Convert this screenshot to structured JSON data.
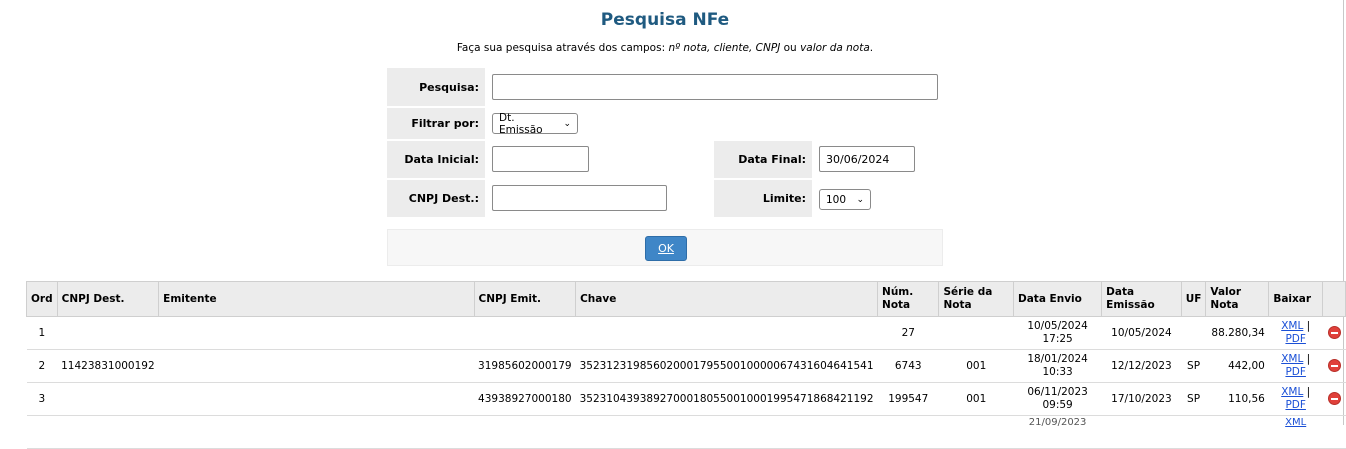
{
  "page": {
    "title": "Pesquisa NFe",
    "subtitle_prefix": "Faça sua pesquisa através dos campos: ",
    "subtitle_fields": "nº nota, cliente, CNPJ",
    "subtitle_or": " ou ",
    "subtitle_last": "valor da nota",
    "subtitle_end": "."
  },
  "form": {
    "search_label": "Pesquisa:",
    "search_value": "",
    "filter_label": "Filtrar por:",
    "filter_value": "Dt. Emissão",
    "start_date_label": "Data Inicial:",
    "start_date_value": "",
    "end_date_label": "Data Final:",
    "end_date_value": "30/06/2024",
    "cnpj_label": "CNPJ Dest.:",
    "cnpj_value": "",
    "limit_label": "Limite:",
    "limit_value": "100",
    "ok_label": "OK"
  },
  "table": {
    "headers": {
      "ord": "Ord",
      "cnpj_dest": "CNPJ Dest.",
      "emitente": "Emitente",
      "cnpj_emit": "CNPJ Emit.",
      "chave": "Chave",
      "num_nota_1": "Núm.",
      "num_nota_2": "Nota",
      "serie_1": "Série da",
      "serie_2": "Nota",
      "data_envio": "Data Envio",
      "data_emissao_1": "Data",
      "data_emissao_2": "Emissão",
      "uf": "UF",
      "valor_1": "Valor",
      "valor_2": "Nota",
      "baixar": "Baixar"
    },
    "links": {
      "xml": "XML",
      "sep": "|",
      "pdf": "PDF"
    },
    "rows": [
      {
        "ord": "1",
        "cnpj_dest": "",
        "emitente": "",
        "cnpj_emit": "",
        "chave": "",
        "num": "27",
        "serie": "",
        "envio_date": "10/05/2024",
        "envio_time": "17:25",
        "emissao": "10/05/2024",
        "uf": "",
        "valor": "88.280,34"
      },
      {
        "ord": "2",
        "cnpj_dest": "11423831000192",
        "emitente": "",
        "cnpj_emit": "31985602000179",
        "chave": "35231231985602000179550010000067431604641541",
        "num": "6743",
        "serie": "001",
        "envio_date": "18/01/2024",
        "envio_time": "10:33",
        "emissao": "12/12/2023",
        "uf": "SP",
        "valor": "442,00"
      },
      {
        "ord": "3",
        "cnpj_dest": "",
        "emitente": "",
        "cnpj_emit": "43938927000180",
        "chave": "35231043938927000180550010001995471868421192",
        "num": "199547",
        "serie": "001",
        "envio_date": "06/11/2023",
        "envio_time": "09:59",
        "emissao": "17/10/2023",
        "uf": "SP",
        "valor": "110,56"
      }
    ],
    "partial_row_date": "21/09/2023"
  }
}
